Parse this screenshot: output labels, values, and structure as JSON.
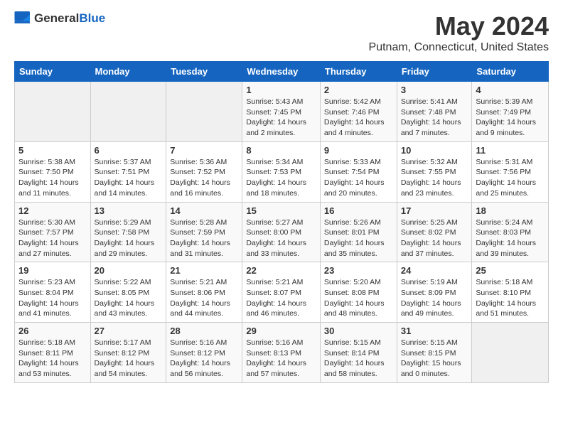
{
  "logo": {
    "text_general": "General",
    "text_blue": "Blue"
  },
  "title": "May 2024",
  "location": "Putnam, Connecticut, United States",
  "weekdays": [
    "Sunday",
    "Monday",
    "Tuesday",
    "Wednesday",
    "Thursday",
    "Friday",
    "Saturday"
  ],
  "weeks": [
    [
      {
        "day": "",
        "info": ""
      },
      {
        "day": "",
        "info": ""
      },
      {
        "day": "",
        "info": ""
      },
      {
        "day": "1",
        "info": "Sunrise: 5:43 AM\nSunset: 7:45 PM\nDaylight: 14 hours\nand 2 minutes."
      },
      {
        "day": "2",
        "info": "Sunrise: 5:42 AM\nSunset: 7:46 PM\nDaylight: 14 hours\nand 4 minutes."
      },
      {
        "day": "3",
        "info": "Sunrise: 5:41 AM\nSunset: 7:48 PM\nDaylight: 14 hours\nand 7 minutes."
      },
      {
        "day": "4",
        "info": "Sunrise: 5:39 AM\nSunset: 7:49 PM\nDaylight: 14 hours\nand 9 minutes."
      }
    ],
    [
      {
        "day": "5",
        "info": "Sunrise: 5:38 AM\nSunset: 7:50 PM\nDaylight: 14 hours\nand 11 minutes."
      },
      {
        "day": "6",
        "info": "Sunrise: 5:37 AM\nSunset: 7:51 PM\nDaylight: 14 hours\nand 14 minutes."
      },
      {
        "day": "7",
        "info": "Sunrise: 5:36 AM\nSunset: 7:52 PM\nDaylight: 14 hours\nand 16 minutes."
      },
      {
        "day": "8",
        "info": "Sunrise: 5:34 AM\nSunset: 7:53 PM\nDaylight: 14 hours\nand 18 minutes."
      },
      {
        "day": "9",
        "info": "Sunrise: 5:33 AM\nSunset: 7:54 PM\nDaylight: 14 hours\nand 20 minutes."
      },
      {
        "day": "10",
        "info": "Sunrise: 5:32 AM\nSunset: 7:55 PM\nDaylight: 14 hours\nand 23 minutes."
      },
      {
        "day": "11",
        "info": "Sunrise: 5:31 AM\nSunset: 7:56 PM\nDaylight: 14 hours\nand 25 minutes."
      }
    ],
    [
      {
        "day": "12",
        "info": "Sunrise: 5:30 AM\nSunset: 7:57 PM\nDaylight: 14 hours\nand 27 minutes."
      },
      {
        "day": "13",
        "info": "Sunrise: 5:29 AM\nSunset: 7:58 PM\nDaylight: 14 hours\nand 29 minutes."
      },
      {
        "day": "14",
        "info": "Sunrise: 5:28 AM\nSunset: 7:59 PM\nDaylight: 14 hours\nand 31 minutes."
      },
      {
        "day": "15",
        "info": "Sunrise: 5:27 AM\nSunset: 8:00 PM\nDaylight: 14 hours\nand 33 minutes."
      },
      {
        "day": "16",
        "info": "Sunrise: 5:26 AM\nSunset: 8:01 PM\nDaylight: 14 hours\nand 35 minutes."
      },
      {
        "day": "17",
        "info": "Sunrise: 5:25 AM\nSunset: 8:02 PM\nDaylight: 14 hours\nand 37 minutes."
      },
      {
        "day": "18",
        "info": "Sunrise: 5:24 AM\nSunset: 8:03 PM\nDaylight: 14 hours\nand 39 minutes."
      }
    ],
    [
      {
        "day": "19",
        "info": "Sunrise: 5:23 AM\nSunset: 8:04 PM\nDaylight: 14 hours\nand 41 minutes."
      },
      {
        "day": "20",
        "info": "Sunrise: 5:22 AM\nSunset: 8:05 PM\nDaylight: 14 hours\nand 43 minutes."
      },
      {
        "day": "21",
        "info": "Sunrise: 5:21 AM\nSunset: 8:06 PM\nDaylight: 14 hours\nand 44 minutes."
      },
      {
        "day": "22",
        "info": "Sunrise: 5:21 AM\nSunset: 8:07 PM\nDaylight: 14 hours\nand 46 minutes."
      },
      {
        "day": "23",
        "info": "Sunrise: 5:20 AM\nSunset: 8:08 PM\nDaylight: 14 hours\nand 48 minutes."
      },
      {
        "day": "24",
        "info": "Sunrise: 5:19 AM\nSunset: 8:09 PM\nDaylight: 14 hours\nand 49 minutes."
      },
      {
        "day": "25",
        "info": "Sunrise: 5:18 AM\nSunset: 8:10 PM\nDaylight: 14 hours\nand 51 minutes."
      }
    ],
    [
      {
        "day": "26",
        "info": "Sunrise: 5:18 AM\nSunset: 8:11 PM\nDaylight: 14 hours\nand 53 minutes."
      },
      {
        "day": "27",
        "info": "Sunrise: 5:17 AM\nSunset: 8:12 PM\nDaylight: 14 hours\nand 54 minutes."
      },
      {
        "day": "28",
        "info": "Sunrise: 5:16 AM\nSunset: 8:12 PM\nDaylight: 14 hours\nand 56 minutes."
      },
      {
        "day": "29",
        "info": "Sunrise: 5:16 AM\nSunset: 8:13 PM\nDaylight: 14 hours\nand 57 minutes."
      },
      {
        "day": "30",
        "info": "Sunrise: 5:15 AM\nSunset: 8:14 PM\nDaylight: 14 hours\nand 58 minutes."
      },
      {
        "day": "31",
        "info": "Sunrise: 5:15 AM\nSunset: 8:15 PM\nDaylight: 15 hours\nand 0 minutes."
      },
      {
        "day": "",
        "info": ""
      }
    ]
  ]
}
